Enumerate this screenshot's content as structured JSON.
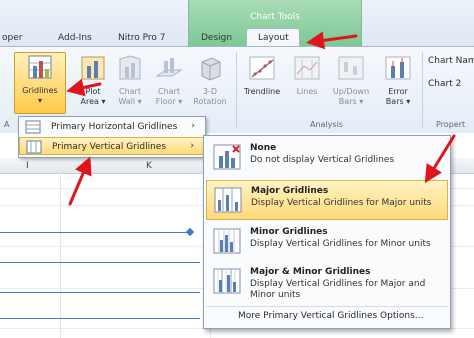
{
  "tabs": {
    "t0": "oper",
    "t1": "Add-Ins",
    "t2": "Nitro Pro 7",
    "t3": "Design",
    "t4": "Layout",
    "tools_title": "Chart Tools"
  },
  "ribbon": {
    "gridlines": "Gridlines",
    "plot_area": [
      "Plot",
      "Area ▾"
    ],
    "chart_wall": [
      "Chart",
      "Wall ▾"
    ],
    "chart_floor": [
      "Chart",
      "Floor ▾"
    ],
    "rotation": [
      "3-D",
      "Rotation"
    ],
    "trendline": "Trendline",
    "lines": "Lines",
    "updown": [
      "Up/Down",
      "Bars ▾"
    ],
    "error": [
      "Error",
      "Bars ▾"
    ],
    "chart_name_label": "Chart Name",
    "chart_name_value": "Chart 2",
    "group_axes": "A",
    "group_analysis": "Analysis",
    "group_props": "Propert"
  },
  "sheet": {
    "col_i": "I",
    "col_k": "K"
  },
  "menu1": {
    "horizontal": "Primary Horizontal Gridlines",
    "vertical": "Primary Vertical Gridlines",
    "arrow": "›"
  },
  "menu2": {
    "none_title": "None",
    "none_desc": "Do not display Vertical Gridlines",
    "major_title": "Major Gridlines",
    "major_desc": "Display Vertical Gridlines for Major units",
    "minor_title": "Minor Gridlines",
    "minor_desc": "Display Vertical Gridlines for Minor units",
    "both_title": "Major & Minor Gridlines",
    "both_desc": "Display Vertical Gridlines for Major and Minor units",
    "more": "More Primary Vertical Gridlines Options..."
  },
  "colors": {
    "accent_red": "#e0151b",
    "highlight": "#ffd978",
    "chart_tools_green": "#7cc892"
  }
}
